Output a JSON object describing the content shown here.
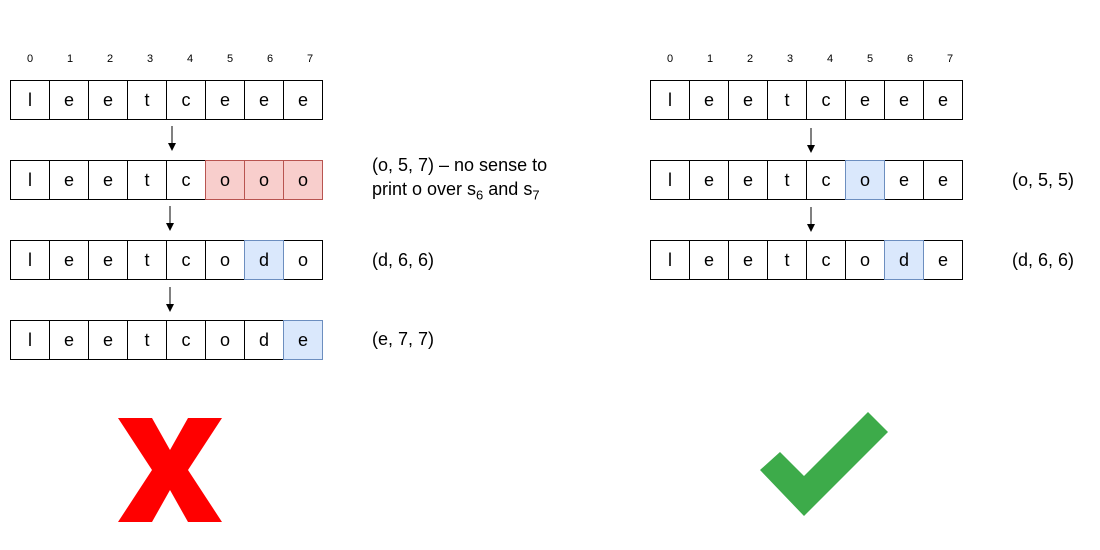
{
  "indices": [
    "0",
    "1",
    "2",
    "3",
    "4",
    "5",
    "6",
    "7"
  ],
  "left": {
    "rows": [
      {
        "cells": [
          "l",
          "e",
          "e",
          "t",
          "c",
          "e",
          "e",
          "e"
        ],
        "highlight": [],
        "label": []
      },
      {
        "cells": [
          "l",
          "e",
          "e",
          "t",
          "c",
          "o",
          "o",
          "o"
        ],
        "highlight": [
          5,
          6,
          7
        ],
        "highlight_color": "red",
        "label": [
          "(o, 5, 7) – no sense to",
          "print o over s",
          "6",
          " and s",
          "7"
        ]
      },
      {
        "cells": [
          "l",
          "e",
          "e",
          "t",
          "c",
          "o",
          "d",
          "o"
        ],
        "highlight": [
          6
        ],
        "highlight_color": "blue",
        "label": [
          "(d, 6, 6)"
        ]
      },
      {
        "cells": [
          "l",
          "e",
          "e",
          "t",
          "c",
          "o",
          "d",
          "e"
        ],
        "highlight": [
          7
        ],
        "highlight_color": "blue",
        "label": [
          "(e, 7, 7)"
        ]
      }
    ],
    "result_icon": "cross-icon"
  },
  "right": {
    "rows": [
      {
        "cells": [
          "l",
          "e",
          "e",
          "t",
          "c",
          "e",
          "e",
          "e"
        ],
        "highlight": [],
        "label": []
      },
      {
        "cells": [
          "l",
          "e",
          "e",
          "t",
          "c",
          "o",
          "e",
          "e"
        ],
        "highlight": [
          5
        ],
        "highlight_color": "blue",
        "label": [
          "(o, 5, 5)"
        ]
      },
      {
        "cells": [
          "l",
          "e",
          "e",
          "t",
          "c",
          "o",
          "d",
          "e"
        ],
        "highlight": [
          6
        ],
        "highlight_color": "blue",
        "label": [
          "(d, 6, 6)"
        ]
      }
    ],
    "result_icon": "check-icon"
  },
  "colors": {
    "red_fill": "#f8cecc",
    "red_stroke": "#b85450",
    "blue_fill": "#dae8fc",
    "blue_stroke": "#6c8ebf",
    "cross": "#ff0000",
    "check": "#3dab4a"
  }
}
